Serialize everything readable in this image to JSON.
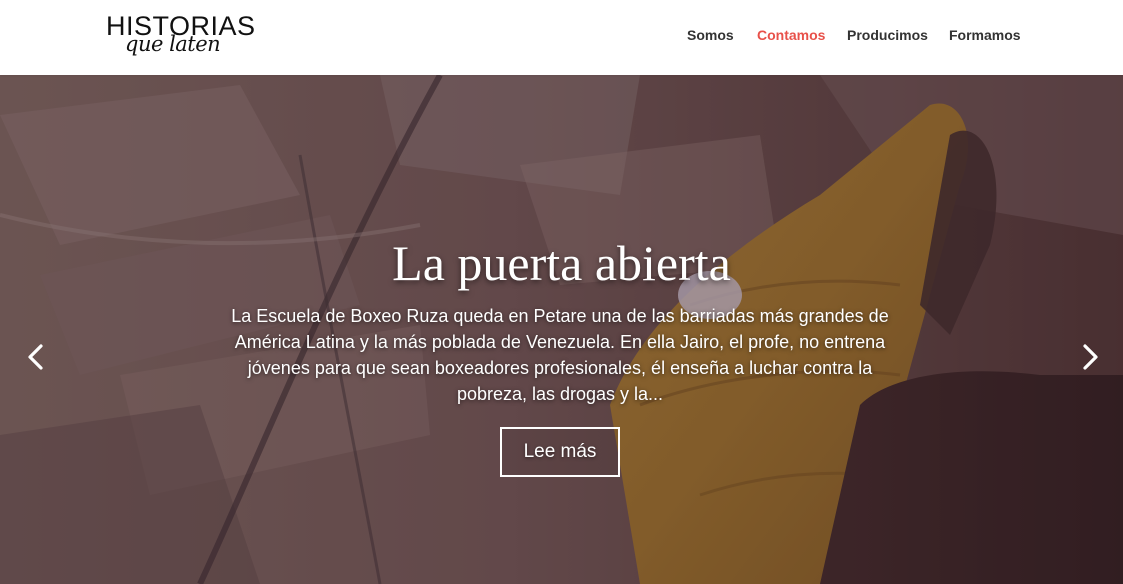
{
  "brand": {
    "logo_main": "HISTORIAS",
    "logo_sub": "que laten"
  },
  "nav": {
    "items": [
      {
        "label": "Somos",
        "active": false
      },
      {
        "label": "Contamos",
        "active": true
      },
      {
        "label": "Producimos",
        "active": false
      },
      {
        "label": "Formamos",
        "active": false
      }
    ]
  },
  "slide": {
    "title": "La puerta abierta",
    "excerpt": "La Escuela de Boxeo Ruza queda en Petare una de las barriadas más grandes de América Latina y la más poblada de Venezuela. En ella Jairo, el profe, no entrena jóvenes para que sean boxeadores profesionales, él enseña a luchar contra la pobreza, las drogas y la...",
    "cta_label": "Lee más"
  },
  "controls": {
    "prev_icon": "chevron-left-icon",
    "next_icon": "chevron-right-icon"
  },
  "colors": {
    "accent": "#e8514a",
    "nav_text": "#333333",
    "header_bg": "#ffffff",
    "hero_text": "#ffffff"
  }
}
